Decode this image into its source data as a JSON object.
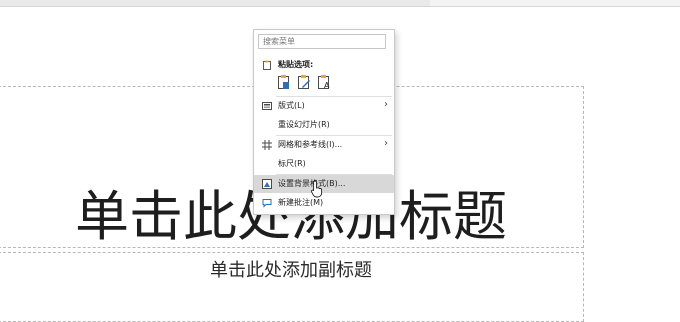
{
  "slide": {
    "title_placeholder": "单击此处添加标题",
    "subtitle_placeholder": "单击此处添加副标题"
  },
  "menu": {
    "search_placeholder": "搜索菜单",
    "paste_header": "粘贴选项:",
    "paste_options": [
      "paste-keep-source-icon",
      "paste-use-destination-icon",
      "paste-text-only-icon"
    ],
    "items": [
      {
        "label": "版式(L)",
        "icon": "layout-icon",
        "submenu": true
      },
      {
        "label": "重设幻灯片(R)",
        "icon": "",
        "submenu": false
      },
      {
        "label": "网格和参考线(I)...",
        "icon": "grid-icon",
        "submenu": true
      },
      {
        "label": "标尺(R)",
        "icon": "",
        "submenu": false
      },
      {
        "label": "设置背景格式(B)...",
        "icon": "background-format-icon",
        "submenu": false,
        "highlighted": true
      },
      {
        "label": "新建批注(M)",
        "icon": "comment-icon",
        "submenu": false
      }
    ]
  },
  "colors": {
    "highlight": "#d8d8d8",
    "paste_accent": "#e8a838",
    "icon_blue": "#2e6fb8"
  }
}
